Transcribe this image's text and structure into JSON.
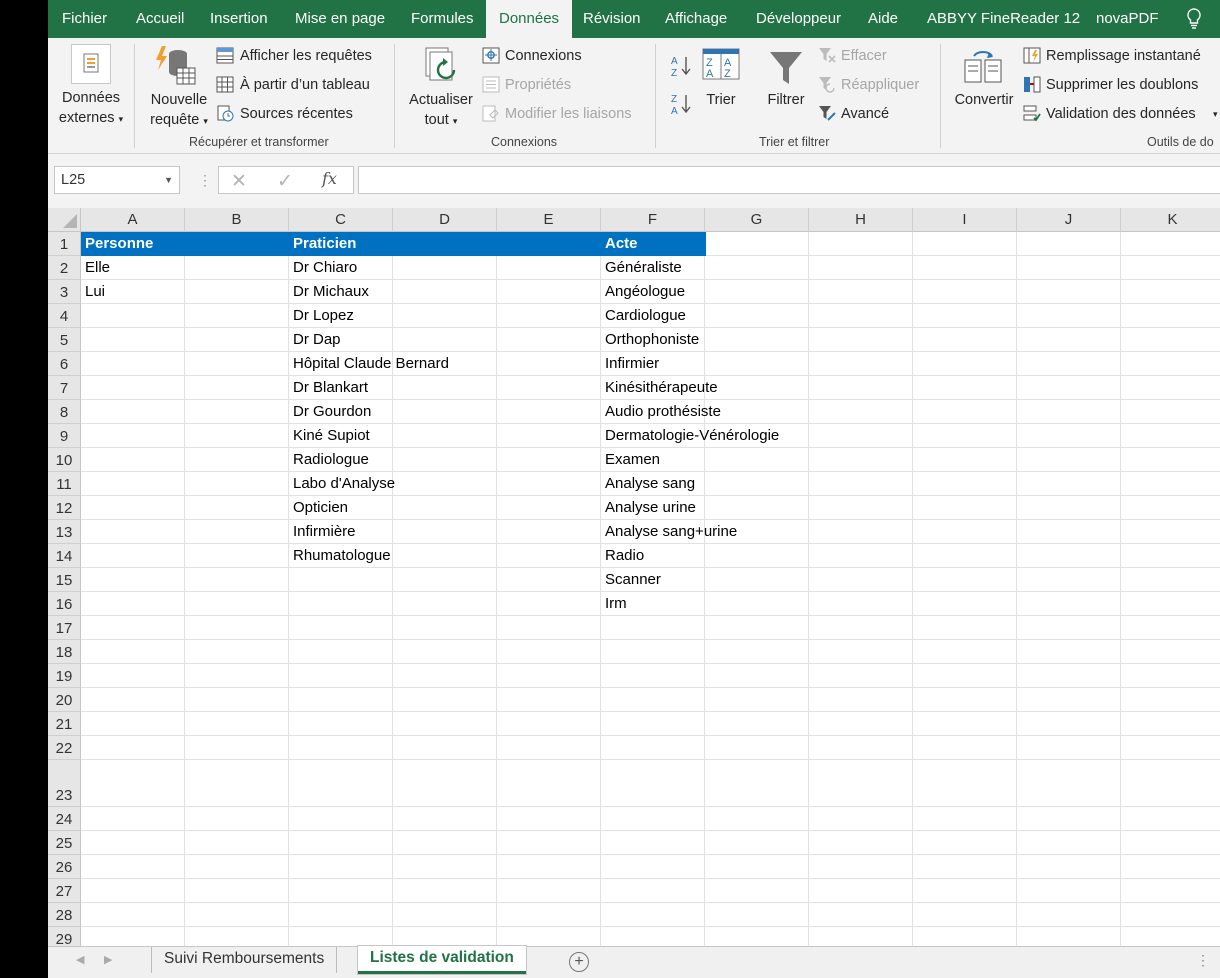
{
  "menu": [
    "Fichier",
    "Accueil",
    "Insertion",
    "Mise en page",
    "Formules",
    "Données",
    "Révision",
    "Affichage",
    "Développeur",
    "Aide",
    "ABBYY FineReader 12",
    "novaPDF"
  ],
  "active_menu": "Données",
  "ribbon": {
    "donnees_externes": [
      "Données",
      "externes"
    ],
    "nouvelle_requete": [
      "Nouvelle",
      "requête"
    ],
    "afficher_requetes": "Afficher les requêtes",
    "a_partir_tableau": "À partir d’un tableau",
    "sources_recentes": "Sources récentes",
    "group_recuperer": "Récupérer et transformer",
    "actualiser_tout": [
      "Actualiser",
      "tout"
    ],
    "connexions": "Connexions",
    "proprietes": "Propriétés",
    "modifier_liaisons": "Modifier les liaisons",
    "group_connexions": "Connexions",
    "trier": "Trier",
    "filtrer": "Filtrer",
    "effacer": "Effacer",
    "reappliquer": "Réappliquer",
    "avance": "Avancé",
    "group_trier": "Trier et filtrer",
    "convertir": "Convertir",
    "remplissage": "Remplissage instantané",
    "supprimer_doublons": "Supprimer les doublons",
    "validation": "Validation des données",
    "group_outils": "Outils de do"
  },
  "formula_bar": {
    "name_box": "L25",
    "fx": "fx",
    "value": ""
  },
  "columns": [
    "A",
    "B",
    "C",
    "D",
    "E",
    "F",
    "G",
    "H",
    "I",
    "J",
    "K"
  ],
  "rows": [
    "1",
    "2",
    "3",
    "4",
    "5",
    "6",
    "7",
    "8",
    "9",
    "10",
    "11",
    "12",
    "13",
    "14",
    "15",
    "16",
    "17",
    "18",
    "19",
    "20",
    "21",
    "22",
    "23",
    "24",
    "25",
    "26",
    "27",
    "28",
    "29"
  ],
  "table": {
    "headers": {
      "personne": "Personne",
      "praticien": "Praticien",
      "acte": "Acte"
    },
    "personne": [
      "Elle",
      "Lui"
    ],
    "praticien": [
      "Dr Chiaro",
      "Dr Michaux",
      "Dr Lopez",
      "Dr Dap",
      "Hôpital Claude Bernard",
      "Dr Blankart",
      "Dr Gourdon",
      "Kiné Supiot",
      "Radiologue",
      "Labo d'Analyse",
      "Opticien",
      "Infirmière",
      "Rhumatologue"
    ],
    "acte": [
      "Généraliste",
      "Angéologue",
      "Cardiologue",
      "Orthophoniste",
      "Infirmier",
      "Kinésithérapeute",
      "Audio prothésiste",
      "Dermatologie-Vénérologie",
      "Examen",
      "Analyse sang",
      "Analyse urine",
      "Analyse sang+urine",
      "Radio",
      "Scanner",
      "Irm"
    ]
  },
  "sheets": [
    "Suivi Remboursements",
    "Listes de validation"
  ],
  "active_sheet": "Listes de validation",
  "colors": {
    "excel_green": "#217346",
    "header_blue": "#0070c0"
  }
}
